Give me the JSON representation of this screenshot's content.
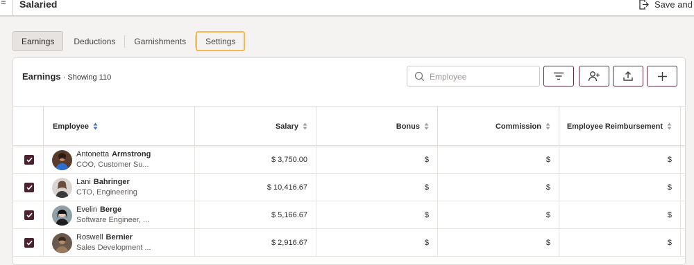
{
  "header": {
    "title": "Salaried",
    "save_label": "Save and"
  },
  "tabs": [
    {
      "label": "Earnings",
      "state": "active"
    },
    {
      "label": "Deductions",
      "state": "normal"
    },
    {
      "label": "Garnishments",
      "state": "normal"
    },
    {
      "label": "Settings",
      "state": "focused"
    }
  ],
  "card": {
    "title": "Earnings",
    "subtitle": " · Showing 110",
    "search_placeholder": "Employee"
  },
  "table": {
    "columns": [
      "Employee",
      "Salary",
      "Bonus",
      "Commission",
      "Employee Reimbursement"
    ],
    "rows": [
      {
        "first": "Antonetta",
        "last": "Armstrong",
        "role": "COO, Customer Su...",
        "salary": "$ 3,750.00",
        "bonus": "$",
        "commission": "$",
        "reimbursement": "$"
      },
      {
        "first": "Lani",
        "last": "Bahringer",
        "role": "CTO, Engineering",
        "salary": "$ 10,416.67",
        "bonus": "$",
        "commission": "$",
        "reimbursement": "$"
      },
      {
        "first": "Evelin",
        "last": "Berge",
        "role": "Software Engineer, ...",
        "salary": "$ 5,166.67",
        "bonus": "$",
        "commission": "$",
        "reimbursement": "$"
      },
      {
        "first": "Roswell",
        "last": "Bernier",
        "role": "Sales Development ...",
        "salary": "$ 2,916.67",
        "bonus": "$",
        "commission": "$",
        "reimbursement": "$"
      }
    ]
  },
  "colors": {
    "brand": "#5a2a38",
    "checkbox": "#4a2230",
    "focus": "#f5b94a",
    "sort_active": "#3f6fc6"
  },
  "icons": [
    "save-exit-icon",
    "search-icon",
    "filter-icon",
    "add-user-icon",
    "upload-icon",
    "plus-icon",
    "sort-icon",
    "checkbox-checked-icon"
  ]
}
